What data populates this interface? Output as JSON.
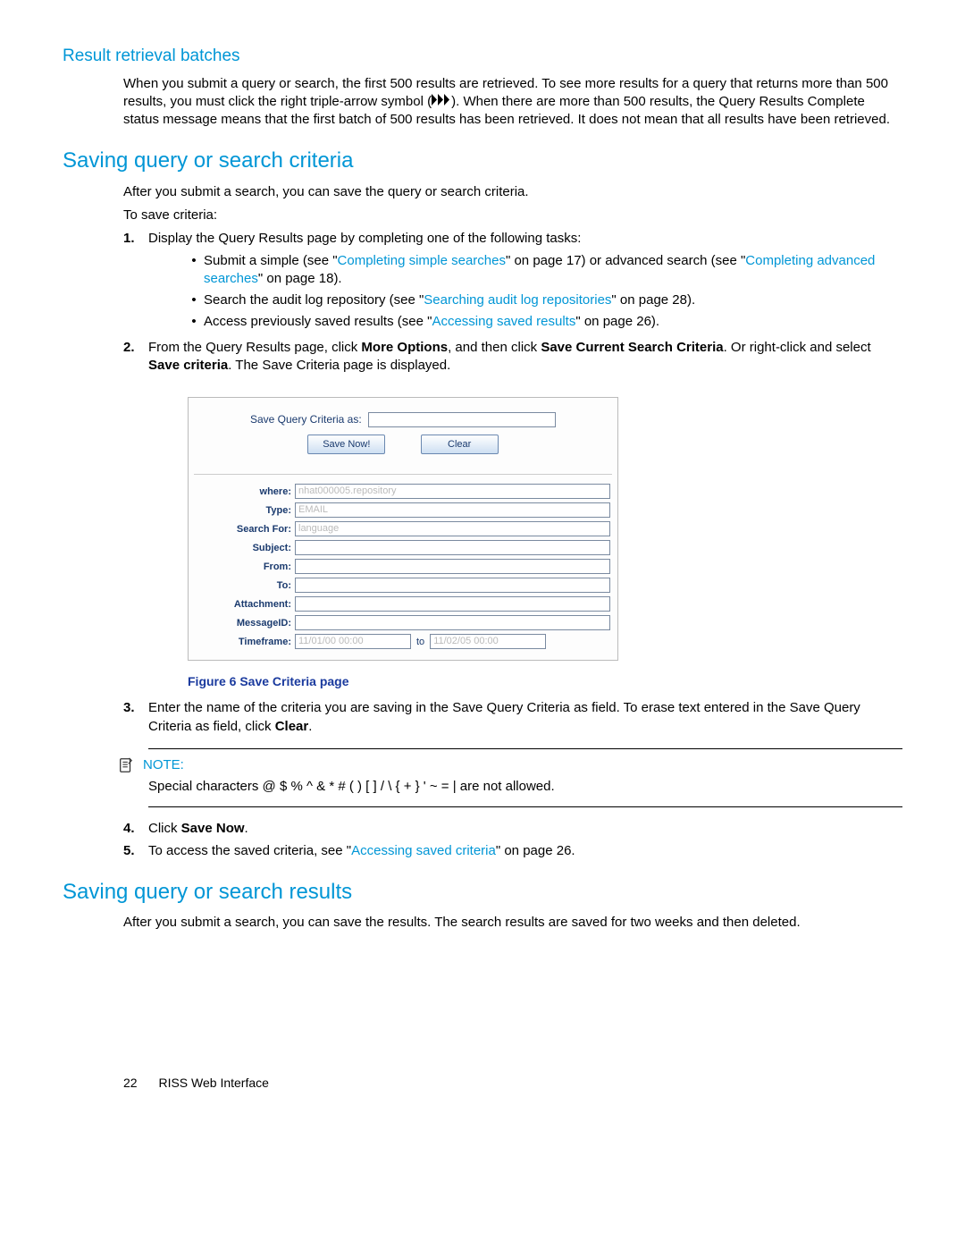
{
  "section1": {
    "title": "Result retrieval batches",
    "para_pre": "When you submit a query or search, the first 500 results are retrieved. To see more results for a query that returns more than 500 results, you must click the right triple-arrow symbol (",
    "para_post": "). When there are more than 500 results, the Query Results Complete status message means that the first batch of 500 results has been retrieved. It does not mean that all results have been retrieved."
  },
  "section2": {
    "title": "Saving query or search criteria",
    "intro": "After you submit a search, you can save the query or search criteria.",
    "tosave": "To save criteria:",
    "step1": "Display the Query Results page by completing one of the following tasks:",
    "b1_pre": "Submit a simple (see \"",
    "b1_link": "Completing simple searches",
    "b1_mid": "\" on page 17) or advanced search (see \"",
    "b1_link2": "Completing advanced searches",
    "b1_post": "\" on page 18).",
    "b2_pre": "Search the audit log repository (see \"",
    "b2_link": "Searching audit log repositories",
    "b2_post": "\" on page 28).",
    "b3_pre": "Access previously saved results (see \"",
    "b3_link": "Accessing saved results",
    "b3_post": "\" on page 26).",
    "step2_pre": "From the Query Results page, click ",
    "step2_b1": "More Options",
    "step2_mid1": ", and then click ",
    "step2_b2": "Save Current Search Criteria",
    "step2_mid2": ". Or right-click and select ",
    "step2_b3": "Save criteria",
    "step2_post": ". The Save Criteria page is displayed.",
    "step3_pre": "Enter the name of the criteria you are saving in the Save Query Criteria as field. To erase text entered in the Save Query Criteria as field, click ",
    "step3_b": "Clear",
    "step3_post": ".",
    "step4_pre": "Click ",
    "step4_b": "Save Now",
    "step4_post": ".",
    "step5_pre": "To access the saved criteria, see \"",
    "step5_link": "Accessing saved criteria",
    "step5_post": "\" on page 26."
  },
  "figure": {
    "save_as_label": "Save Query Criteria as:",
    "save_btn": "Save Now!",
    "clear_btn": "Clear",
    "fields": {
      "where_label": "where:",
      "where_val": "nhat000005.repository",
      "type_label": "Type:",
      "type_val": "EMAIL",
      "searchfor_label": "Search For:",
      "searchfor_val": "language",
      "subject_label": "Subject:",
      "from_label": "From:",
      "to_label": "To:",
      "attachment_label": "Attachment:",
      "messageid_label": "MessageID:",
      "timeframe_label": "Timeframe:",
      "tf_from": "11/01/00 00:00",
      "tf_to_label": "to",
      "tf_to": "11/02/05 00:00"
    },
    "caption": "Figure 6 Save Criteria page"
  },
  "note": {
    "label": "NOTE:",
    "body": "Special characters @ $ % ^ & * # ( ) [ ] / \\ { + } ' ~ = | are not allowed."
  },
  "section3": {
    "title": "Saving query or search results",
    "para": "After you submit a search, you can save the results. The search results are saved for two weeks and then deleted."
  },
  "footer": {
    "page": "22",
    "text": "RISS Web Interface"
  },
  "nums": {
    "n1": "1.",
    "n2": "2.",
    "n3": "3.",
    "n4": "4.",
    "n5": "5."
  }
}
